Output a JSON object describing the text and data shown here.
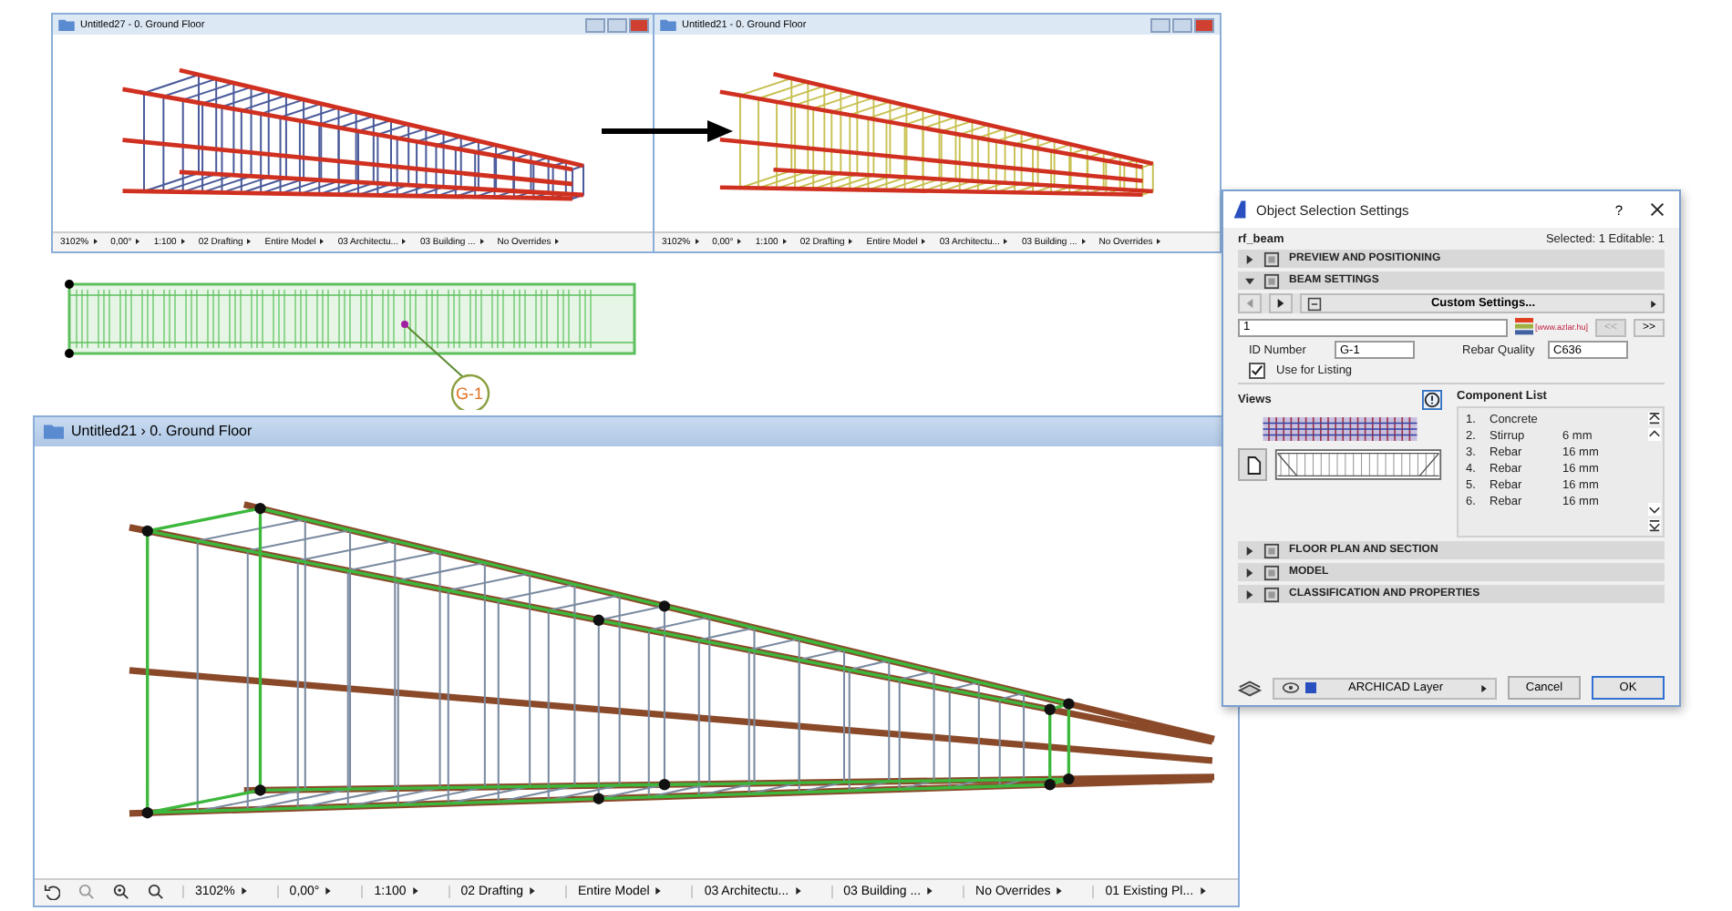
{
  "small_windows": [
    {
      "title": "Untitled27 - 0. Ground Floor",
      "kind": "before",
      "status_bar": [
        "3102%",
        "0,00°",
        "1:100",
        "02 Drafting",
        "Entire Model",
        "03 Architectu...",
        "03 Building ...",
        "No Overrides"
      ]
    },
    {
      "title": "Untitled21 - 0. Ground Floor",
      "kind": "after",
      "status_bar": [
        "3102%",
        "0,00°",
        "1:100",
        "02 Drafting",
        "Entire Model",
        "03 Architectu...",
        "03 Building ...",
        "No Overrides"
      ]
    }
  ],
  "plan": {
    "tag": "G-1"
  },
  "main_window": {
    "title": "Untitled21 › 0. Ground Floor",
    "status_bar": [
      "3102%",
      "0,00°",
      "1:100",
      "02 Drafting",
      "Entire Model",
      "03 Architectu...",
      "03 Building ...",
      "No Overrides",
      "01 Existing Pl..."
    ]
  },
  "dialog": {
    "title": "Object Selection Settings",
    "help": "?",
    "object_name": "rf_beam",
    "selection_info": "Selected: 1 Editable: 1",
    "sections_top": [
      {
        "title": "PREVIEW AND POSITIONING",
        "expanded": false
      },
      {
        "title": "BEAM SETTINGS",
        "expanded": true
      }
    ],
    "preset": "Custom Settings...",
    "name_value": "1",
    "logo_text": "[www.azlar.hu]",
    "prev_button": "<<",
    "prev_disabled": true,
    "next_button": ">>",
    "id_label": "ID Number",
    "id_value": "G-1",
    "quality_label": "Rebar Quality",
    "quality_value": "C636",
    "listing": {
      "label": "Use for Listing",
      "checked": true
    },
    "views_label": "Views",
    "component_label": "Component List",
    "components": [
      {
        "index": "1.",
        "name": "Concrete"
      },
      {
        "index": "2.",
        "name": "Stirrup",
        "size": "6 mm"
      },
      {
        "index": "3.",
        "name": "Rebar",
        "size": "16 mm"
      },
      {
        "index": "4.",
        "name": "Rebar",
        "size": "16 mm"
      },
      {
        "index": "5.",
        "name": "Rebar",
        "size": "16 mm"
      },
      {
        "index": "6.",
        "name": "Rebar",
        "size": "16 mm"
      }
    ],
    "sections_bottom": [
      {
        "title": "FLOOR PLAN AND SECTION",
        "expanded": false
      },
      {
        "title": "MODEL",
        "expanded": false
      },
      {
        "title": "CLASSIFICATION AND PROPERTIES",
        "expanded": false
      }
    ],
    "layer": "ARCHICAD Layer",
    "cancel": "Cancel",
    "ok": "OK"
  }
}
